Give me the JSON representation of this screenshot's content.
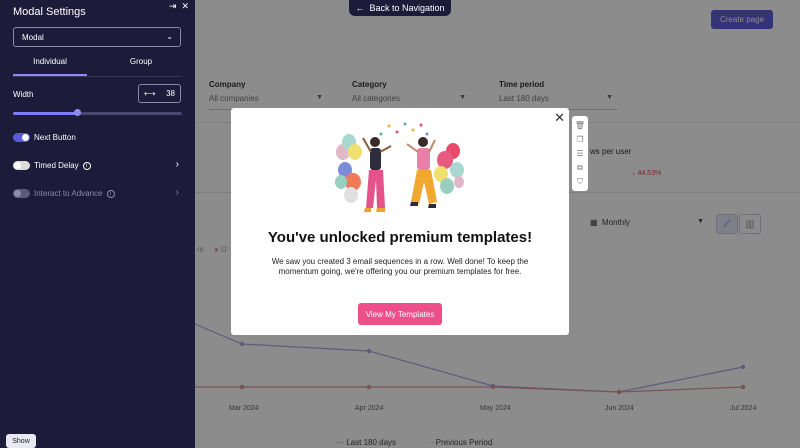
{
  "nav": {
    "back_label": "Back to Navigation",
    "back_icon": "arrow-left-icon"
  },
  "page": {
    "create_label": "Create page"
  },
  "filters": [
    {
      "label": "Company",
      "value": "All companies"
    },
    {
      "label": "Category",
      "value": "All categories"
    },
    {
      "label": "Time period",
      "value": "Last 180 days"
    }
  ],
  "kpi": {
    "title_partial": "ws per user",
    "change": "44.53%"
  },
  "chart_controls": {
    "period": "Monthly"
  },
  "chart_data": {
    "type": "line",
    "x": [
      "Mar 2024",
      "Apr 2024",
      "May 2024",
      "Jun 2024",
      "Jul 2024"
    ],
    "series": [
      {
        "name": "Last 180 days",
        "color": "#a9a9e0"
      },
      {
        "name": "Previous Period",
        "color": "#d99a9a"
      }
    ],
    "legend_fragments": [
      "rs",
      "U"
    ]
  },
  "panel": {
    "title": "Modal Settings",
    "type_select": "Modal",
    "tabs": [
      "Individual",
      "Group"
    ],
    "width": {
      "label": "Width",
      "value": "38",
      "fraction": 0.38
    },
    "options": [
      {
        "label": "Next Button",
        "state": "on",
        "info": false,
        "arrow": false
      },
      {
        "label": "Timed Delay",
        "state": "off",
        "info": true,
        "arrow": true
      },
      {
        "label": "Interact to Advance",
        "state": "disabled",
        "info": true,
        "arrow": true
      }
    ],
    "show_label": "Show"
  },
  "modal": {
    "title": "You've unlocked premium templates!",
    "body": "We saw you created 3 email sequences in a row. Well done! To keep the momentum going, we're offering you our premium templates for free.",
    "cta": "View My Templates",
    "close_icon": "close-icon",
    "toolbar_icons": [
      "trash-icon",
      "copy-icon",
      "settings-icon",
      "duplicate-icon",
      "bookmark-icon"
    ]
  },
  "colors": {
    "panel_bg": "#1d1b3a",
    "accent": "#7c7cf0",
    "cta": "#ee4f88"
  }
}
